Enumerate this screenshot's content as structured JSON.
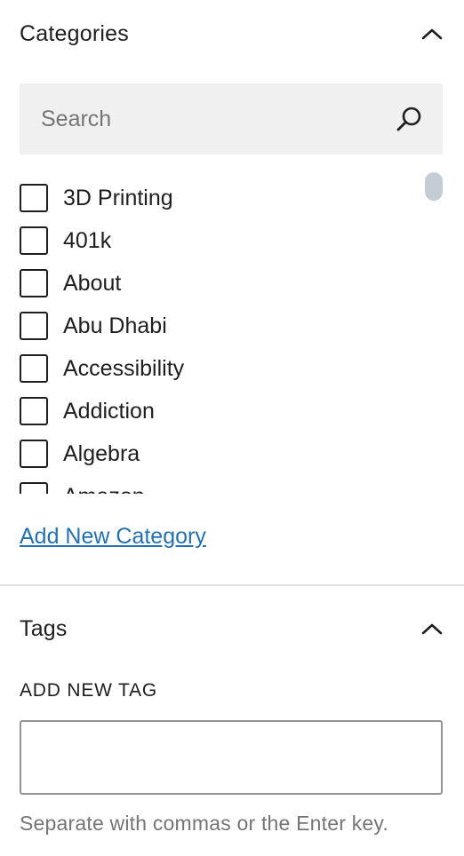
{
  "categories_panel": {
    "title": "Categories",
    "search": {
      "placeholder": "Search",
      "value": ""
    },
    "items": [
      {
        "label": "3D Printing",
        "checked": false
      },
      {
        "label": "401k",
        "checked": false
      },
      {
        "label": "About",
        "checked": false
      },
      {
        "label": "Abu Dhabi",
        "checked": false
      },
      {
        "label": "Accessibility",
        "checked": false
      },
      {
        "label": "Addiction",
        "checked": false
      },
      {
        "label": "Algebra",
        "checked": false
      },
      {
        "label": "Amazon",
        "checked": false
      }
    ],
    "add_new_label": "Add New Category",
    "collapse_icon": "chevron-up-icon",
    "search_icon": "search-icon"
  },
  "tags_panel": {
    "title": "Tags",
    "add_new_label": "ADD NEW TAG",
    "input_value": "",
    "help_text": "Separate with commas or the Enter key.",
    "collapse_icon": "chevron-up-icon"
  },
  "colors": {
    "link": "#2271b1",
    "text": "#1e1e1e",
    "muted": "#757575",
    "search_bg": "#f0f0f0"
  }
}
